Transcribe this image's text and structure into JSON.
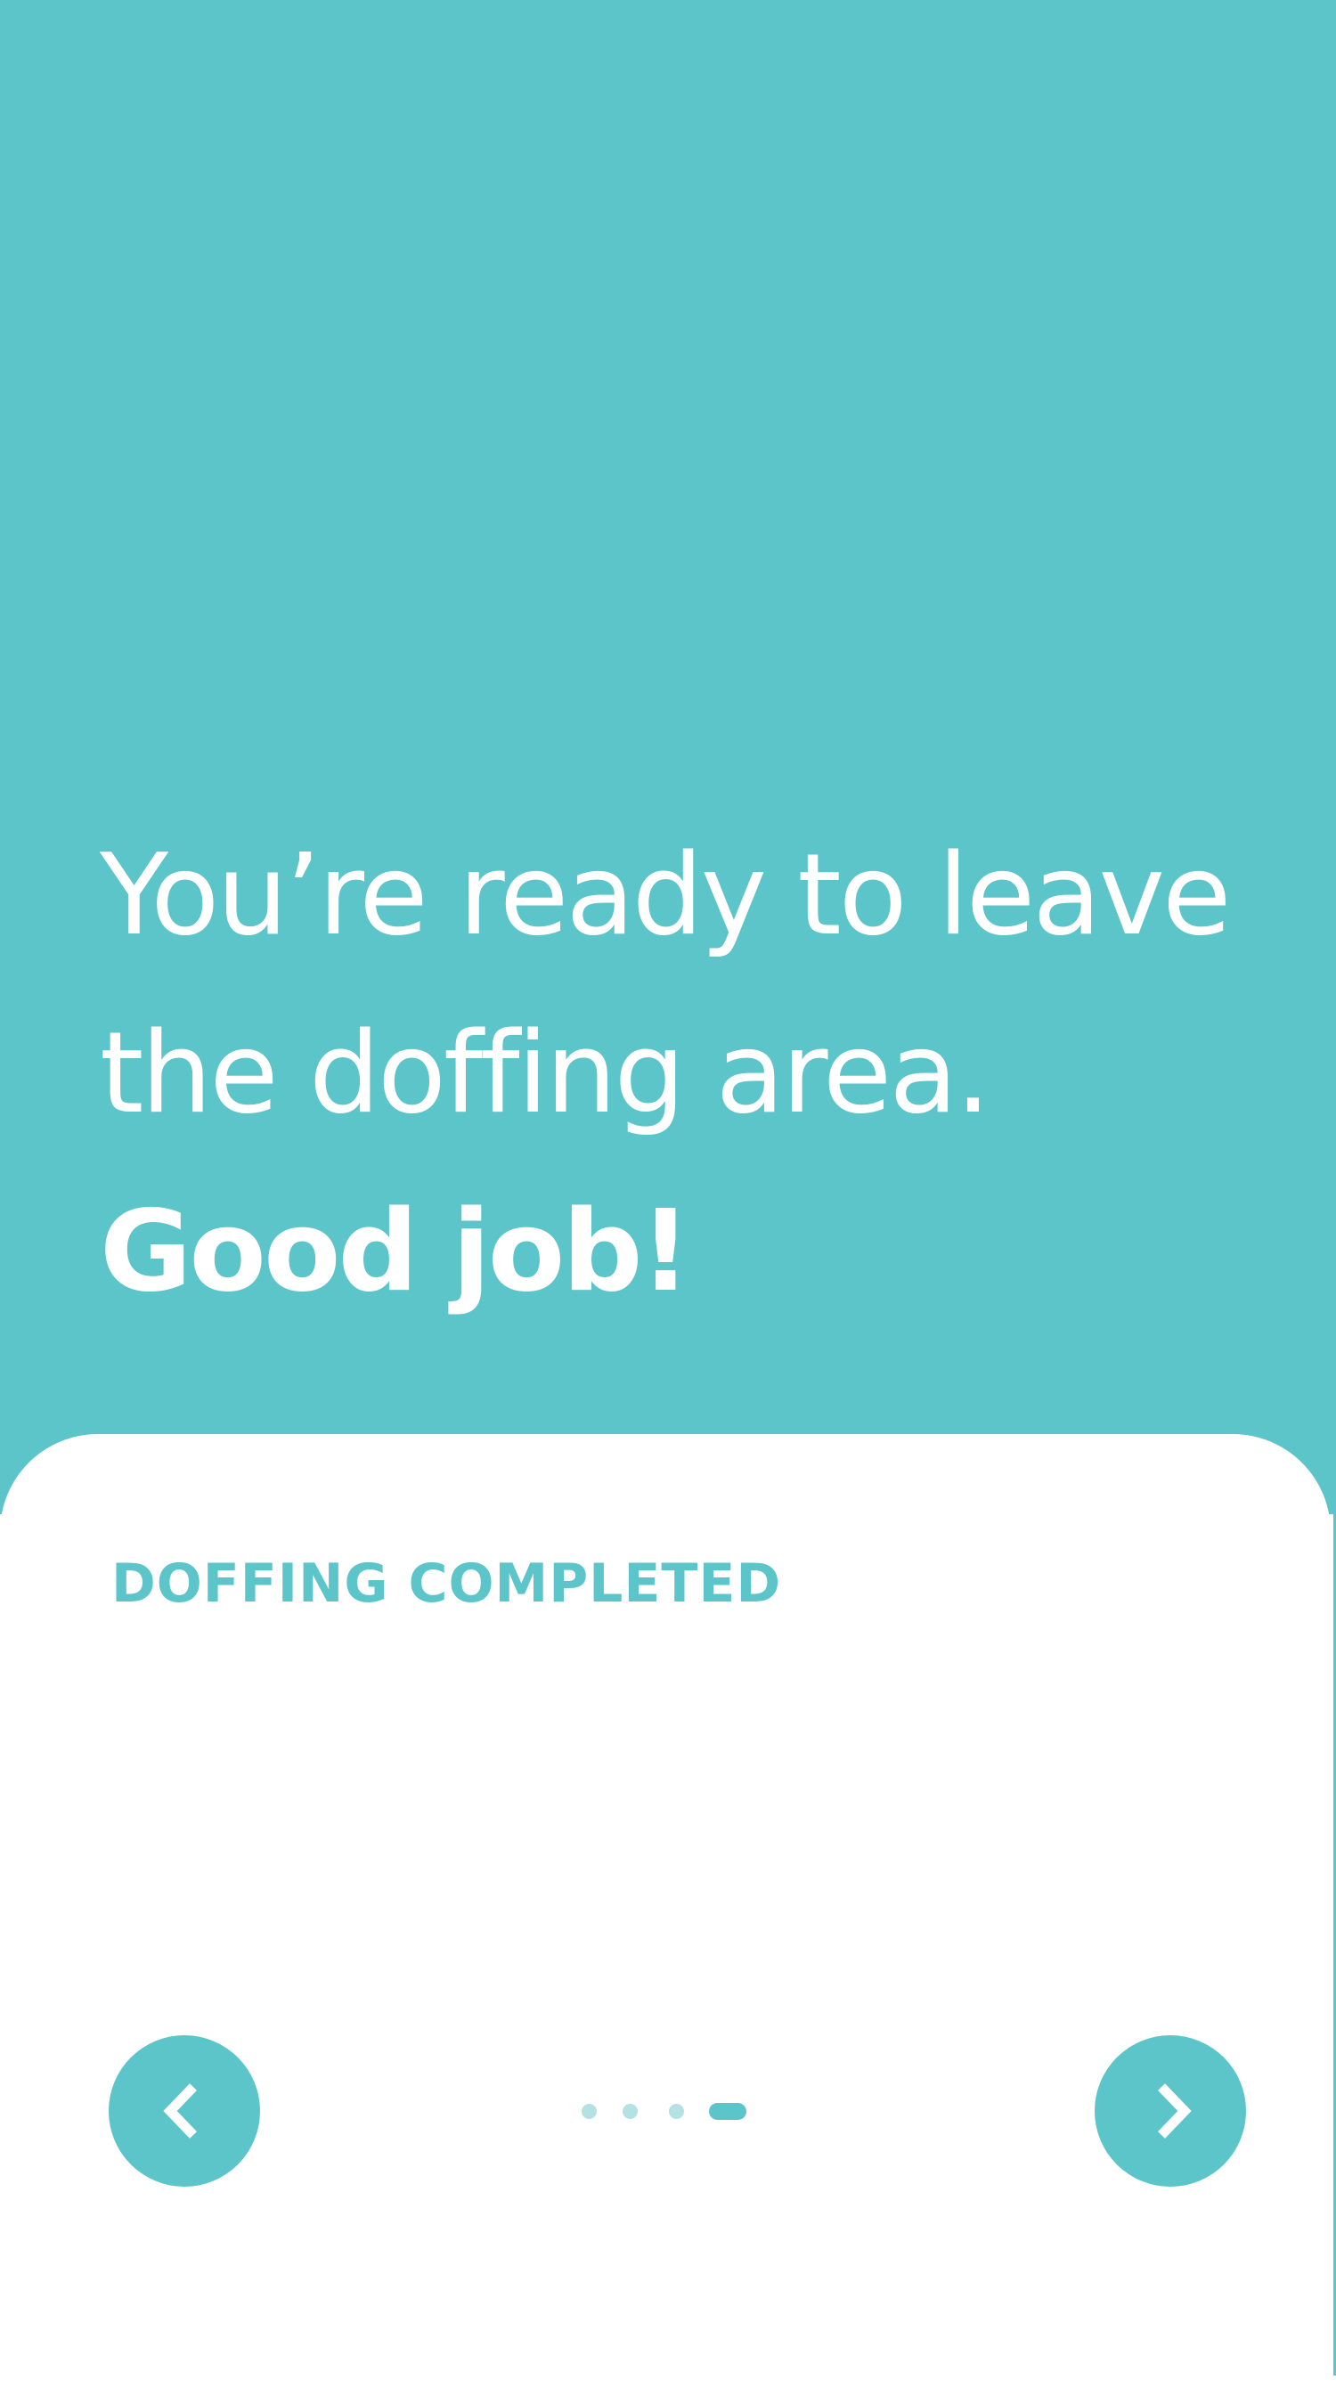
{
  "colors": {
    "accent": "#5cc5ca",
    "background": "#ffffff",
    "text_on_accent": "#ffffff",
    "dot_inactive": "#b3e1e4"
  },
  "hero": {
    "line1": "You’re ready to leave",
    "line2": "the doffing area.",
    "line3": "Good job!"
  },
  "card": {
    "status_label": "DOFFING COMPLETED"
  },
  "navigation": {
    "prev_icon": "chevron-left-icon",
    "next_icon": "chevron-right-icon",
    "total_steps": 4,
    "current_step": 4
  }
}
